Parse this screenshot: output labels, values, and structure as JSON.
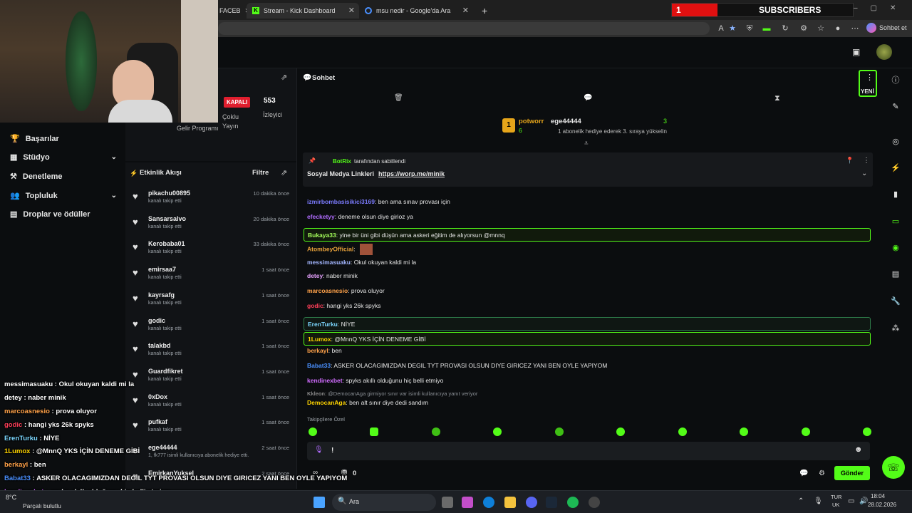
{
  "browser": {
    "tabs": [
      {
        "label": "FACEB",
        "active": false
      },
      {
        "label": "Stream - Kick Dashboard",
        "active": true
      },
      {
        "label": "msu nedir - Google'da Ara",
        "active": false
      }
    ],
    "new_tab": "+",
    "chat_button": "Sohbet et"
  },
  "subscribers": {
    "count": "1",
    "label": "SUBSCRIBERS"
  },
  "sidebar": {
    "items": [
      {
        "label": "Başarılar",
        "icon": "trophy-icon"
      },
      {
        "label": "Stüdyo",
        "icon": "studio-icon",
        "expand": "⌄"
      },
      {
        "label": "Denetleme",
        "icon": "gavel-icon"
      },
      {
        "label": "Topluluk",
        "icon": "community-icon",
        "expand": "⌄"
      },
      {
        "label": "Droplar ve ödüller",
        "icon": "gift-icon"
      }
    ]
  },
  "stats": {
    "status_badge": "KAPALI",
    "multi_stream": "Çoklu Yayın",
    "viewers": "553",
    "viewers_label": "İzleyici",
    "income": "Gelir Programı"
  },
  "activity": {
    "title": "Etkinlik Akışı",
    "filter": "Filtre",
    "items": [
      {
        "name": "pikachu00895",
        "sub": "kanalı takip etti",
        "time": "10 dakika önce"
      },
      {
        "name": "Sansarsalvo",
        "sub": "kanalı takip etti",
        "time": "20 dakika önce"
      },
      {
        "name": "Kerobaba01",
        "sub": "kanalı takip etti",
        "time": "33 dakika önce"
      },
      {
        "name": "emirsaa7",
        "sub": "kanalı takip etti",
        "time": "1 saat önce"
      },
      {
        "name": "kayrsafg",
        "sub": "kanalı takip etti",
        "time": "1 saat önce"
      },
      {
        "name": "godic",
        "sub": "kanalı takip etti",
        "time": "1 saat önce"
      },
      {
        "name": "talakbd",
        "sub": "kanalı takip etti",
        "time": "1 saat önce"
      },
      {
        "name": "Guardfikret",
        "sub": "kanalı takip etti",
        "time": "1 saat önce"
      },
      {
        "name": "0xDox",
        "sub": "kanalı takip etti",
        "time": "1 saat önce"
      },
      {
        "name": "pufkaf",
        "sub": "kanalı takip etti",
        "time": "1 saat önce"
      },
      {
        "name": "ege44444",
        "sub": "1, fk777 isimli kullanıcıya abonelik hediye etti.",
        "time": "2 saat önce"
      },
      {
        "name": "EmirkanYuksel",
        "sub": "",
        "time": "2 saat önce"
      }
    ]
  },
  "chat": {
    "title": "Sohbet",
    "new_label": "YENİ",
    "leaderboard": {
      "first_user": "potworr",
      "first_count": "6",
      "second_user": "ege44444",
      "second_count": "3",
      "second_note": "1 abonelik hediye ederek 3. sıraya yükselin"
    },
    "pinned": {
      "pinned_by": "BotRix",
      "pinned_suffix": "tarafından sabitlendi",
      "text": "Sosyal Medya Linkleri",
      "link": "https://worp.me/minik"
    },
    "messages": [
      {
        "user": "izmirbomba­sisikici3169",
        "text": "ben ama sınav provası için",
        "color": "#7c7cff"
      },
      {
        "user": "efecketyy",
        "text": "deneme olsun diye girioz ya",
        "color": "#b16cff"
      },
      {
        "user": "Bukaya33",
        "text": "yine bir üni gibi düşün ama askeri eğitim de alıyorsun @mnnq",
        "color": "#a6ff5c"
      },
      {
        "user": "AtombeyOfficial",
        "text": "",
        "color": "#e8a23a"
      },
      {
        "user": "messimasuaku",
        "text": "Okul okuyan kaldi mi la",
        "color": "#a3b6ff"
      },
      {
        "user": "detey",
        "text": "naber minik",
        "color": "#e7a2ff"
      },
      {
        "user": "marcoasnesio",
        "text": "prova oluyor",
        "color": "#ffa24a"
      },
      {
        "user": "godic",
        "text": "hangi yks 26k spyks",
        "color": "#ff3f5a"
      },
      {
        "user": "ErenTurku",
        "text": "NİYE",
        "color": "#7cd7ff"
      },
      {
        "user": "1Lumox",
        "text": "@MnnQ YKS İÇİN DENEME GİBİ",
        "color": "#ffd400"
      },
      {
        "user": "berkayl",
        "text": "ben",
        "color": "#ffa24a"
      },
      {
        "user": "Babat33",
        "text": "ASKER OLACAGIMIZDAN DEGIL TYT PROVASI OLSUN DIYE GIRICEZ YANI BEN OYLE YAPIYOM",
        "color": "#4a90ff"
      },
      {
        "user": "kendinexbet",
        "text": "spyks akıllı olduğunu hiç belli etmiyo",
        "color": "#d16cff"
      },
      {
        "user": "Kkleon",
        "text": "@DemocanAga girmiyor sınır var isimli kullanıcıya yanıt veriyor",
        "color": "#888"
      },
      {
        "user": "DemocanAga",
        "text": "ben alt sınır diye dedi sandım",
        "color": "#ffd400"
      }
    ],
    "followers_only": "Takipçilere Özel",
    "input_value": "!",
    "send": "Gönder",
    "points": "0"
  },
  "overlay_chat": [
    {
      "user": "messimasuaku",
      "text": "Okul okuyan kaldi mi la",
      "color": "#ffffff"
    },
    {
      "user": "detey",
      "text": "naber minik",
      "color": "#ffffff"
    },
    {
      "user": "marcoasnesio",
      "text": "prova oluyor",
      "color": "#ffa24a"
    },
    {
      "user": "godic",
      "text": "hangi yks 26k spyks",
      "color": "#ff3f5a"
    },
    {
      "user": "ErenTurku",
      "text": "NİYE",
      "color": "#7cd7ff"
    },
    {
      "user": "1Lumox",
      "text": "@MnnQ YKS İÇİN DENEME GİBİ",
      "color": "#ffd400"
    },
    {
      "user": "berkayl",
      "text": "ben",
      "color": "#ffa24a"
    },
    {
      "user": "Babat33",
      "text": "ASKER OLACAGIMIZDAN DEGIL TYT PROVASI OLSUN DIYE GIRICEZ YANI BEN OYLE YAPIYOM",
      "color": "#4a90ff"
    },
    {
      "user": "kendinexbet",
      "text": "spyks akıllı olduğunu hiç belli etmiyo",
      "color": "#d16cff"
    }
  ],
  "taskbar": {
    "weather_temp": "8°C",
    "weather_desc": "Parçalı bulutlu",
    "search": "Ara",
    "lang": "TUR",
    "region": "UK",
    "time": "18:04",
    "date": "28.02.2026"
  },
  "colors": {
    "accent": "#53fc18",
    "bg": "#0b0d0f",
    "panel": "#111316"
  }
}
